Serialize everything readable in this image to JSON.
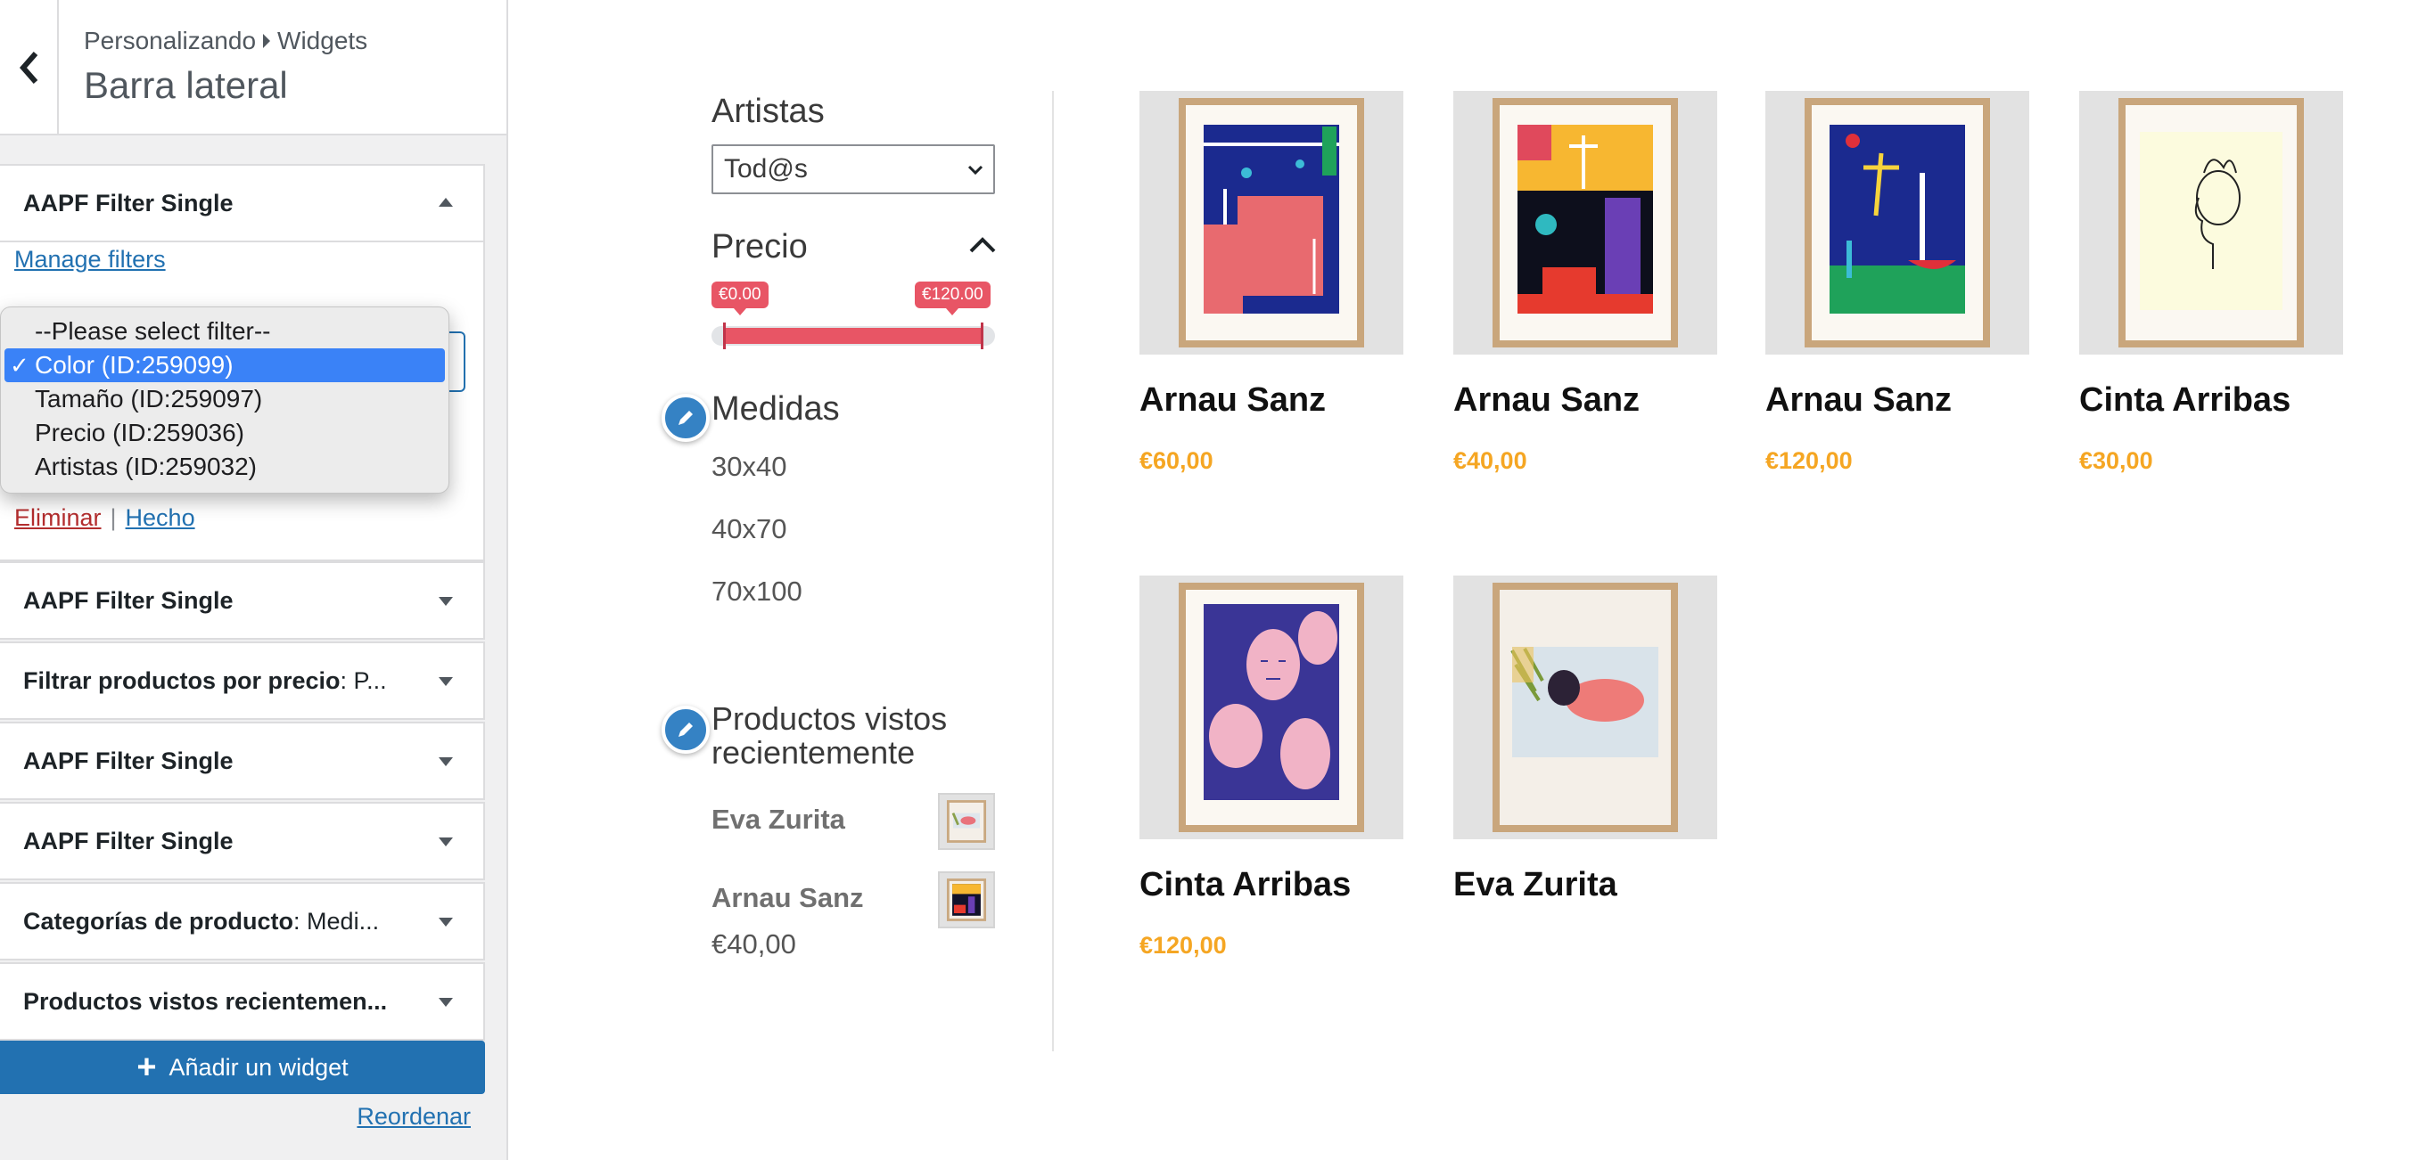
{
  "sidebar": {
    "breadcrumb": [
      "Personalizando",
      "Widgets"
    ],
    "title": "Barra lateral",
    "open_widget": {
      "title": "AAPF Filter Single",
      "manage_filters": "Manage filters",
      "remove": "Eliminar",
      "separator": "|",
      "done": "Hecho",
      "dropdown": {
        "options": [
          "--Please select filter--",
          "Color (ID:259099)",
          "Tamaño (ID:259097)",
          "Precio (ID:259036)",
          "Artistas (ID:259032)"
        ],
        "selected": "Color (ID:259099)",
        "check": "✓"
      }
    },
    "widgets": [
      {
        "title": "AAPF Filter Single",
        "sub": ""
      },
      {
        "title": "Filtrar productos por precio",
        "sub": ": P..."
      },
      {
        "title": "AAPF Filter Single",
        "sub": ""
      },
      {
        "title": "AAPF Filter Single",
        "sub": ""
      },
      {
        "title": "Categorías de producto",
        "sub": ": Medi..."
      },
      {
        "title": "Productos vistos recientemen...",
        "sub": ""
      }
    ],
    "add_widget": "Añadir un widget",
    "reorder": "Reordenar"
  },
  "preview": {
    "artistas": {
      "title": "Artistas",
      "selected": "Tod@s"
    },
    "precio": {
      "title": "Precio",
      "min_label": "€0.00",
      "max_label": "€120.00",
      "min": 0,
      "max": 120
    },
    "medidas": {
      "title": "Medidas",
      "items": [
        "30x40",
        "40x70",
        "70x100"
      ]
    },
    "recent": {
      "title": "Productos vistos recientemente",
      "items": [
        {
          "name": "Eva Zurita",
          "price": ""
        },
        {
          "name": "Arnau Sanz",
          "price": "€40,00"
        }
      ]
    },
    "products": [
      {
        "name": "Arnau Sanz",
        "price": "€60,00"
      },
      {
        "name": "Arnau Sanz",
        "price": "€40,00"
      },
      {
        "name": "Arnau Sanz",
        "price": "€120,00"
      },
      {
        "name": "Cinta Arribas",
        "price": "€30,00"
      },
      {
        "name": "Cinta Arribas",
        "price": "€120,00"
      },
      {
        "name": "Eva Zurita",
        "price": ""
      }
    ]
  },
  "colors": {
    "accent": "#2271b1",
    "price": "#f5a623",
    "slider": "#e85565",
    "dropdown_selected": "#3a82f7"
  }
}
